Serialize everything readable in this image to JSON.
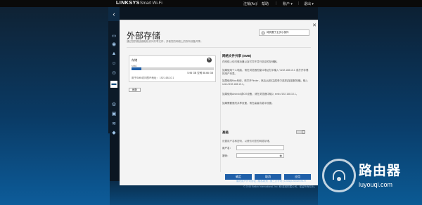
{
  "header": {
    "logo": "LINKSYS",
    "logo_sub": "Smart Wi-Fi",
    "links": [
      "注销(Ax)",
      "帮助",
      "账户 ▾",
      "退出 ▾"
    ]
  },
  "nav": {
    "collapse": "‹",
    "icons": [
      {
        "name": "devices-icon",
        "glyph": "▭"
      },
      {
        "name": "wifi-icon",
        "glyph": "◉"
      },
      {
        "name": "alert-icon",
        "glyph": "▲"
      },
      {
        "name": "parental-icon",
        "glyph": "☺"
      },
      {
        "name": "speed-icon",
        "glyph": "⊙"
      },
      {
        "name": "storage-icon",
        "glyph": "▬"
      },
      {
        "name": "connectivity-icon",
        "glyph": "⚙"
      },
      {
        "name": "troubleshoot-icon",
        "glyph": "▣"
      },
      {
        "name": "wireless-icon",
        "glyph": "≋"
      },
      {
        "name": "security-icon",
        "glyph": "◆"
      }
    ]
  },
  "dialog": {
    "title": "外部存储",
    "subtitle": "通过您的路由器轻松访问共享文件，并使您的网络上的所有设备共享。",
    "checkbox_label": "将其置于主页小部件",
    "close": "✕",
    "storage": {
      "label": "存储",
      "drive_name": "sda1",
      "used_fraction": 0.12,
      "size_text": "5.96 GB 空闲 58.66 GB",
      "address": "用于SMB访问的IP地址：  192.168.10.1",
      "refresh": "刷新"
    },
    "info": {
      "title": "网络文件共享 (SMB)",
      "paragraphs": [
        "在网络上访问驱动器以及它打开并行协议的存储器。",
        "如果使用个人电脑，请在浏览器的窗口地址栏中输入 \\\\192.168.10.1 或打开存储的用户列表。",
        "如果使用Mac系统，请打开Finder，然后从[前往]菜单中选择[连接服务器]，输入 smb://192.168.10.1。",
        "如果使用Android或iOS设备，请在浏览器中输入 smb://192.168.10.1。",
        "如果需要更改共享设置，请在高级功能中设置。"
      ],
      "advanced_label": "高级",
      "cred_note": "设置用户名和密码，以便访问您的网络存储。",
      "username_label": "用户名：",
      "password_label": "密码：",
      "username_value": "",
      "password_value": ""
    },
    "buttons": [
      "确定",
      "取消",
      "应用"
    ]
  },
  "footer": {
    "links": "最终用户许可协议 | 隐私政策 | 第三方许可 | Linksys Smart Wi-Fi",
    "copyright": "© 2016 Belkin International, Inc. 和/或其附属公司。保留所有权利。"
  },
  "watermark": {
    "text": "路由器",
    "url": "luyouqi.com"
  },
  "colors": {
    "accent": "#1f5fa8",
    "topbar": "#0a0a0a",
    "background": "#0b3a64"
  }
}
